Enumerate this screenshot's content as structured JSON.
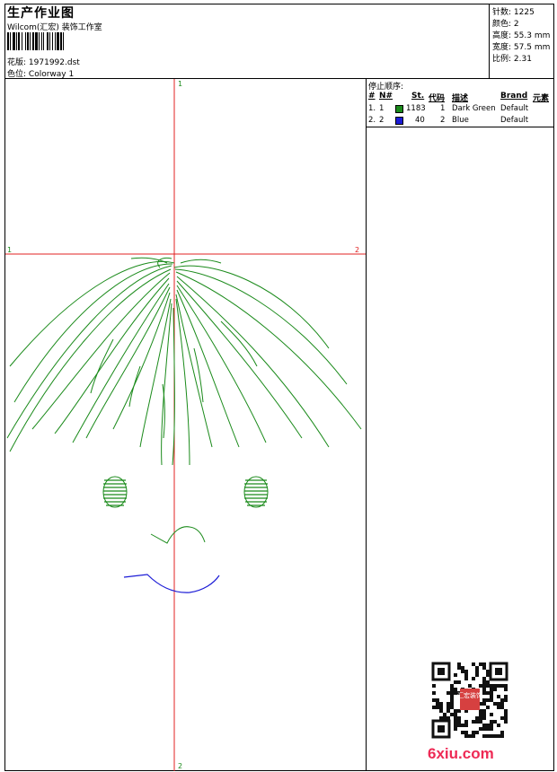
{
  "header": {
    "title": "生产作业图",
    "company": "Wilcom(汇宏) 装饰工作室",
    "design_label": "花版:",
    "design_value": "1971992.dst",
    "colorway_label": "色位:",
    "colorway_value": "Colorway 1"
  },
  "stats": [
    {
      "label": "针数",
      "value": "1225"
    },
    {
      "label": "颜色",
      "value": "2"
    },
    {
      "label": "高度",
      "value": "55.3 mm"
    },
    {
      "label": "宽度",
      "value": "57.5 mm"
    },
    {
      "label": "比例",
      "value": "2.31"
    }
  ],
  "stop_sequence": {
    "title": "停止顺序:",
    "columns": [
      "#",
      "N#",
      "St.",
      "代码",
      "描述",
      "Brand",
      "元素"
    ],
    "rows": [
      {
        "index": "1.",
        "needle": "1",
        "color": "#1a8a1a",
        "stitches": "1183",
        "code": "1",
        "description": "Dark Green",
        "brand": "Default"
      },
      {
        "index": "2.",
        "needle": "2",
        "color": "#1b1bd6",
        "stitches": "40",
        "code": "2",
        "description": "Blue",
        "brand": "Default"
      }
    ]
  },
  "axes": {
    "top": "1",
    "bottom": "2",
    "left": "1",
    "right": "2",
    "color": "#e02020"
  },
  "watermark": "6xiu.com",
  "qr_stamp_text": "汇宏装饰"
}
